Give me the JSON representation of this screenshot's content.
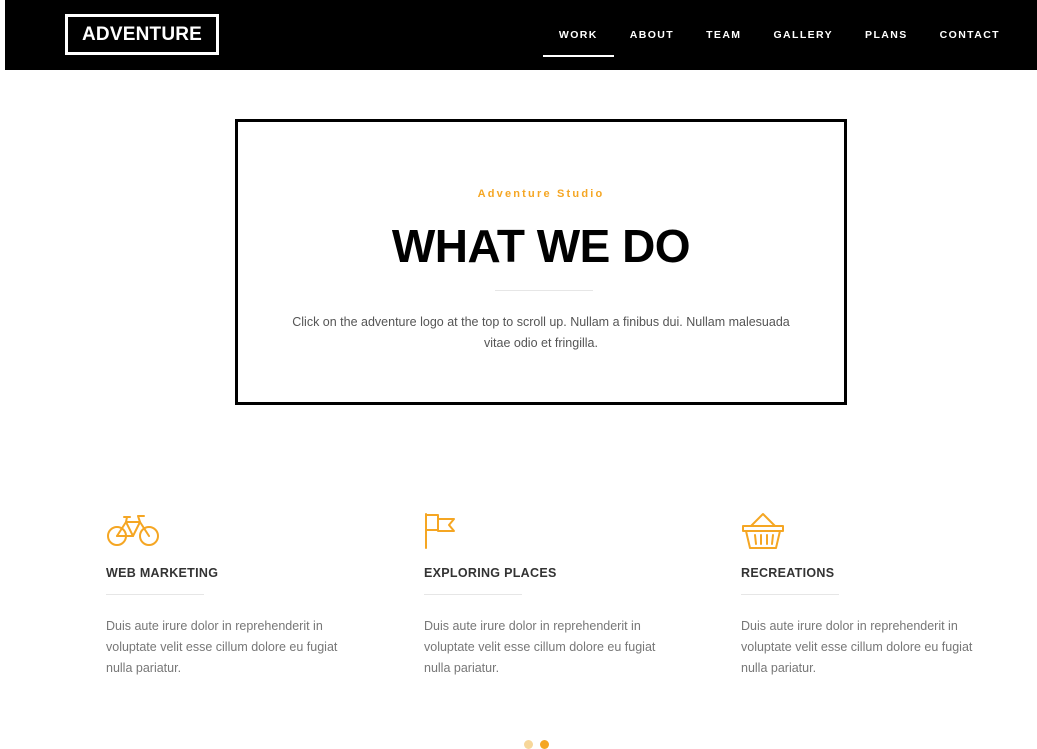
{
  "header": {
    "logo": "ADVENTURE",
    "nav": [
      {
        "label": "WORK",
        "active": true
      },
      {
        "label": "ABOUT",
        "active": false
      },
      {
        "label": "TEAM",
        "active": false
      },
      {
        "label": "GALLERY",
        "active": false
      },
      {
        "label": "PLANS",
        "active": false
      },
      {
        "label": "CONTACT",
        "active": false
      }
    ]
  },
  "hero": {
    "subtitle": "Adventure Studio",
    "title": "WHAT WE DO",
    "text": "Click on the adventure logo at the top to scroll up. Nullam a finibus dui. Nullam malesuada vitae odio et fringilla."
  },
  "features": [
    {
      "icon": "bicycle-icon",
      "title": "WEB MARKETING",
      "text": "Duis aute irure dolor in reprehenderit in voluptate velit esse cillum dolore eu fugiat nulla pariatur."
    },
    {
      "icon": "flag-icon",
      "title": "EXPLORING PLACES",
      "text": "Duis aute irure dolor in reprehenderit in voluptate velit esse cillum dolore eu fugiat nulla pariatur."
    },
    {
      "icon": "basket-icon",
      "title": "RECREATIONS",
      "text": "Duis aute irure dolor in reprehenderit in voluptate velit esse cillum dolore eu fugiat nulla pariatur."
    }
  ],
  "pagination": {
    "count": 2,
    "active_index": 1
  },
  "colors": {
    "accent": "#f5a623",
    "header_bg": "#000000",
    "text": "#555555"
  }
}
